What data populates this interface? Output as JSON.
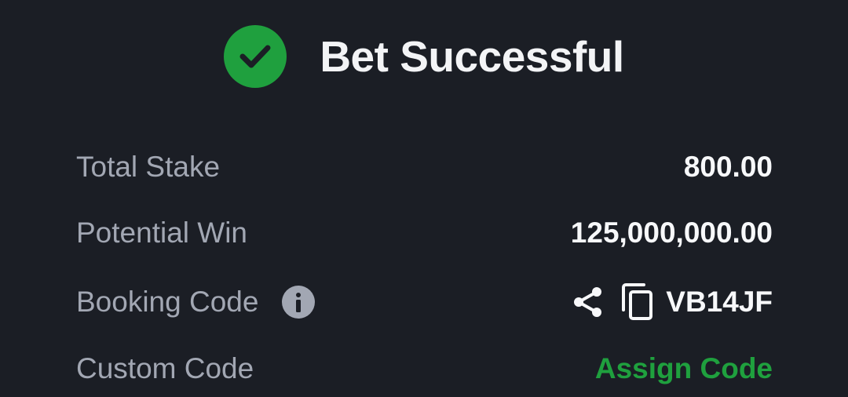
{
  "header": {
    "title": "Bet Successful",
    "icon": "check-circle-icon",
    "icon_color": "#1fa03e"
  },
  "rows": [
    {
      "label": "Total Stake",
      "value": "800.00"
    },
    {
      "label": "Potential Win",
      "value": "125,000,000.00"
    },
    {
      "label": "Booking Code",
      "value": "VB14JF",
      "label_icon": "info-icon",
      "value_icons": [
        "share-icon",
        "copy-icon"
      ]
    },
    {
      "label": "Custom Code",
      "value": "Assign Code",
      "value_color": "#1fa03e"
    }
  ],
  "colors": {
    "background": "#1b1e25",
    "label": "#a2a7b3",
    "value": "#f7f8fa",
    "accent": "#1fa03e"
  }
}
